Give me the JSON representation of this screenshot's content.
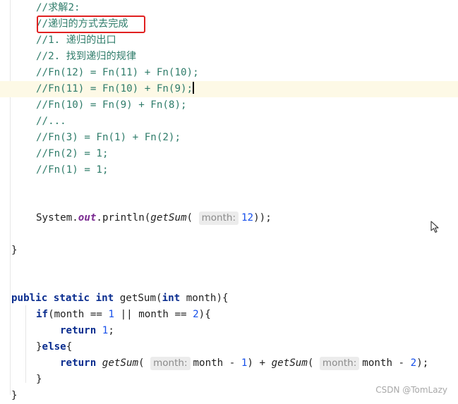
{
  "code": {
    "comment_solve2": "//求解2:",
    "comment_recursion_method": "//递归的方式去完成",
    "comment_exit": "//1. 递归的出口",
    "comment_pattern": "//2. 找到递归的规律",
    "comment_fn12": "//Fn(12) = Fn(11) + Fn(10);",
    "comment_fn11": "//Fn(11) = Fn(10) + Fn(9);",
    "comment_fn10": "//Fn(10) = Fn(9) + Fn(8);",
    "comment_dots": "//...",
    "comment_fn3": "//Fn(3) = Fn(1) + Fn(2);",
    "comment_fn2": "//Fn(2) = 1;",
    "comment_fn1": "//Fn(1) = 1;",
    "println_system": "System.",
    "println_out": "out",
    "println_method": ".println(",
    "println_getsum": "getSum",
    "println_paren": "(",
    "println_hint": "month:",
    "println_arg": "12",
    "println_close": "));",
    "close_main": "}",
    "decl_public": "public",
    "decl_static": "static",
    "decl_int": "int",
    "decl_name": "getSum(",
    "decl_param_type": "int",
    "decl_param": "month){",
    "if_kw": "if",
    "if_open": "(month ==",
    "if_one": "1",
    "if_or": "|| month ==",
    "if_two": "2",
    "if_close": "){",
    "ret1_kw": "return",
    "ret1_val": "1",
    "ret1_semi": ";",
    "else_open": "}",
    "else_kw": "else",
    "else_brace": "{",
    "ret2_kw": "return",
    "ret2_call1": "getSum",
    "ret2_paren1": "(",
    "ret2_hint1": "month:",
    "ret2_expr1": "month -",
    "ret2_num1": "1",
    "ret2_plus": ") +",
    "ret2_call2": "getSum",
    "ret2_paren2": "(",
    "ret2_hint2": "month:",
    "ret2_expr2": "month -",
    "ret2_num2": "2",
    "ret2_end": ");",
    "close_if": "}",
    "close_method": "}"
  },
  "watermark": "CSDN @TomLazy",
  "colors": {
    "highlight_box": "#e02020",
    "comment": "#2f7c6a",
    "keyword": "#0a2d8f",
    "number": "#1750eb",
    "current_line": "#fdf9e6"
  }
}
